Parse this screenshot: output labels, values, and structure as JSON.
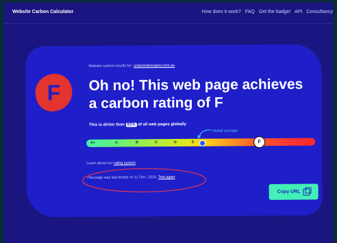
{
  "header": {
    "brand": "Website Carbon Calculator",
    "nav": [
      "How does it work?",
      "FAQ",
      "Get the badge!",
      "API",
      "Consultancy"
    ]
  },
  "result": {
    "results_for_prefix": "Website carbon results for:",
    "site": "untamedescapes.com.au",
    "grade_badge": "F",
    "headline": "Oh no! This web page achieves a carbon rating of F",
    "dirtier_prefix": "This is dirtier than",
    "dirtier_pct": "81%",
    "dirtier_suffix": "of all web pages globally",
    "global_average_label": "Global average",
    "scale_grades": [
      "A+",
      "A",
      "B",
      "C",
      "D",
      "E"
    ],
    "current_grade": "F",
    "learn_prefix": "Learn about our",
    "learn_link": "rating system",
    "tested_prefix": "This page was last tested on 11 Dec, 2024.",
    "test_again": "Test again",
    "copy_url": "Copy URL"
  },
  "colors": {
    "page_bg": "#1a1580",
    "card_bg": "#1e1fc8",
    "accent": "#42f0b6",
    "rating_badge": "#e3342f",
    "annotation": "#e4344f"
  }
}
